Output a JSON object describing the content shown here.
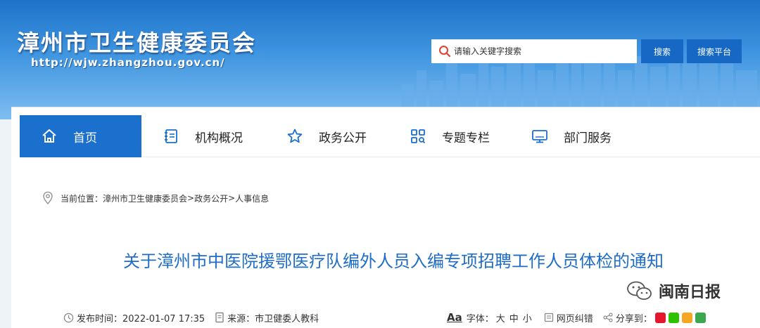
{
  "header": {
    "site_title": "漳州市卫生健康委员会",
    "site_url": "http://wjw.zhangzhou.gov.cn/",
    "search_placeholder": "请输入关键字搜索",
    "search_button": "搜索",
    "search_platform_button": "搜索平台"
  },
  "nav": {
    "items": [
      {
        "label": "首页",
        "icon": "home-icon",
        "active": true
      },
      {
        "label": "机构概况",
        "icon": "document-list-icon",
        "active": false
      },
      {
        "label": "政务公开",
        "icon": "star-icon",
        "active": false
      },
      {
        "label": "专题专栏",
        "icon": "grid-search-icon",
        "active": false
      },
      {
        "label": "部门服务",
        "icon": "monitor-icon",
        "active": false
      }
    ]
  },
  "breadcrumb": {
    "prefix": "当前位置：",
    "items": [
      "漳州市卫生健康委员会",
      "政务公开",
      "人事信息"
    ],
    "separator": ">"
  },
  "article": {
    "title": "关于漳州市中医院援鄂医疗队编外人员入编专项招聘工作人员体检的通知"
  },
  "meta": {
    "publish_time": "发布时间：2022-01-07 17:35",
    "source": "来源：市卫健委人教科",
    "font_label": "字体：",
    "font_sizes": [
      "大",
      "中",
      "小"
    ],
    "error_report": "网页纠错",
    "share_label": "分享到："
  },
  "watermark": {
    "text": "闽南日报"
  },
  "colors": {
    "brand_blue": "#1b6fcd",
    "title_blue": "#1f6dc6"
  }
}
